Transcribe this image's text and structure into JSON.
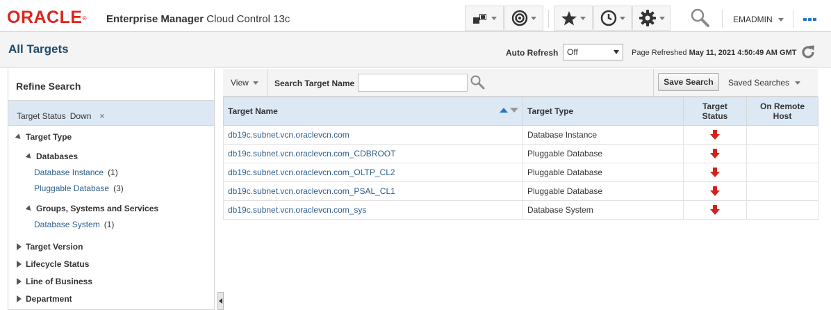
{
  "header": {
    "logo": "ORACLE",
    "logo_mark": "®",
    "product_bold": "Enterprise Manager",
    "product_light": "Cloud Control 13c",
    "user": "EMADMIN"
  },
  "page": {
    "title": "All Targets",
    "auto_refresh_label": "Auto Refresh",
    "auto_refresh_value": "Off",
    "refreshed_prefix": "Page Refreshed",
    "refreshed_value": "May 11, 2021 4:50:49 AM GMT"
  },
  "refine": {
    "title": "Refine Search",
    "chip_label": "Target Status",
    "chip_value": "Down",
    "chip_close": "×",
    "tree": {
      "target_type": "Target Type",
      "databases": "Databases",
      "db_instance": {
        "label": "Database Instance",
        "count": "(1)"
      },
      "pluggable": {
        "label": "Pluggable Database",
        "count": "(3)"
      },
      "groups": "Groups, Systems and Services",
      "db_system": {
        "label": "Database System",
        "count": "(1)"
      },
      "target_version": "Target Version",
      "lifecycle": "Lifecycle Status",
      "line_of_business": "Line of Business",
      "department": "Department"
    }
  },
  "toolbar": {
    "view": "View",
    "search_label": "Search Target Name",
    "search_value": "",
    "save_search": "Save Search",
    "saved_searches": "Saved Searches"
  },
  "table": {
    "columns": {
      "name": "Target Name",
      "type": "Target Type",
      "status_line1": "Target",
      "status_line2": "Status",
      "remote_line1": "On Remote",
      "remote_line2": "Host"
    },
    "sort": {
      "column": "Target Name",
      "direction": "ascending"
    },
    "rows": [
      {
        "name": "db19c.subnet.vcn.oraclevcn.com",
        "type": "Database Instance",
        "status": "down",
        "remote": ""
      },
      {
        "name": "db19c.subnet.vcn.oraclevcn.com_CDBROOT",
        "type": "Pluggable Database",
        "status": "down",
        "remote": ""
      },
      {
        "name": "db19c.subnet.vcn.oraclevcn.com_OLTP_CL2",
        "type": "Pluggable Database",
        "status": "down",
        "remote": ""
      },
      {
        "name": "db19c.subnet.vcn.oraclevcn.com_PSAL_CL1",
        "type": "Pluggable Database",
        "status": "down",
        "remote": ""
      },
      {
        "name": "db19c.subnet.vcn.oraclevcn.com_sys",
        "type": "Database System",
        "status": "down",
        "remote": ""
      }
    ]
  },
  "colors": {
    "oracle_red": "#e2231a",
    "title_blue": "#1c4a6e",
    "link_blue": "#2d5e8f",
    "header_row": "#dce8f4",
    "status_down": "#d6201a"
  },
  "icons": [
    "targets-menu-icon",
    "target-icon",
    "favorites-star-icon",
    "history-clock-icon",
    "setup-gear-icon",
    "global-search-icon",
    "more-dots-icon",
    "refresh-icon",
    "search-icon",
    "status-down-arrow-icon"
  ]
}
